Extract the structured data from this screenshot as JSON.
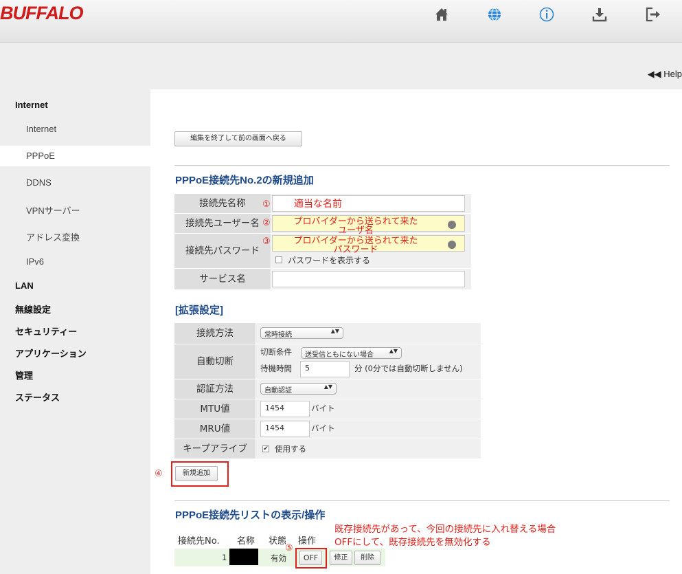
{
  "header": {
    "logo": "BUFFALO",
    "icons": [
      "home-icon",
      "globe-icon",
      "info-icon",
      "download-icon",
      "logout-icon"
    ],
    "help": "◀◀ Help"
  },
  "sidebar": {
    "sections": [
      {
        "label": "Internet"
      },
      {
        "label": "LAN"
      },
      {
        "label": "無線設定"
      },
      {
        "label": "セキュリティー"
      },
      {
        "label": "アプリケーション"
      },
      {
        "label": "管理"
      },
      {
        "label": "ステータス"
      }
    ],
    "items": [
      {
        "label": "Internet"
      },
      {
        "label": "PPPoE"
      },
      {
        "label": "DDNS"
      },
      {
        "label": "VPNサーバー"
      },
      {
        "label": "アドレス変換"
      },
      {
        "label": "IPv6"
      }
    ]
  },
  "main": {
    "back_button": "編集を終了して前の画面へ戻る",
    "section_title": "PPPoE接続先No.2の新規追加",
    "form": {
      "name_label": "接続先名称",
      "user_label": "接続先ユーザー名",
      "pass_label": "接続先パスワード",
      "show_password": "パスワードを表示する",
      "service_label": "サービス名"
    },
    "ext_title": "[拡張設定]",
    "ext": {
      "method_label": "接続方法",
      "method_value": "常時接続",
      "auto_label": "自動切断",
      "cut_cond_label": "切断条件",
      "cut_cond_value": "送受信ともにない場合",
      "wait_label": "待機時間",
      "wait_value": "5",
      "wait_note": "分 (0分では自動切断しません)",
      "auth_label": "認証方法",
      "auth_value": "自動認証",
      "mtu_label": "MTU値",
      "mtu_value": "1454",
      "mtu_unit": "バイト",
      "mru_label": "MRU値",
      "mru_value": "1454",
      "mru_unit": "バイト",
      "keepalive_label": "キープアライブ",
      "keepalive_value": "使用する"
    },
    "add_button": "新規追加",
    "list_title": "PPPoE接続先リストの表示/操作",
    "list": {
      "headers": [
        "接続先No.",
        "名称",
        "状態",
        "操作"
      ],
      "row": {
        "no": "1",
        "state": "有効",
        "off": "OFF",
        "edit": "修正",
        "delete": "削除"
      }
    }
  },
  "annotations": {
    "a1_num": "①",
    "a1_text": "適当な名前",
    "a2_num": "②",
    "a2_line1": "プロバイダーから送られて来た",
    "a2_line2": "ユーザ名",
    "a3_num": "③",
    "a3_line1": "プロバイダーから送られて来た",
    "a3_line2": "パスワード",
    "a4_num": "④",
    "a5_num": "⑤",
    "note_line1": "既存接続先があって、今回の接続先に入れ替える場合",
    "note_line2": "OFFにして、既存接続先を無効化する"
  }
}
